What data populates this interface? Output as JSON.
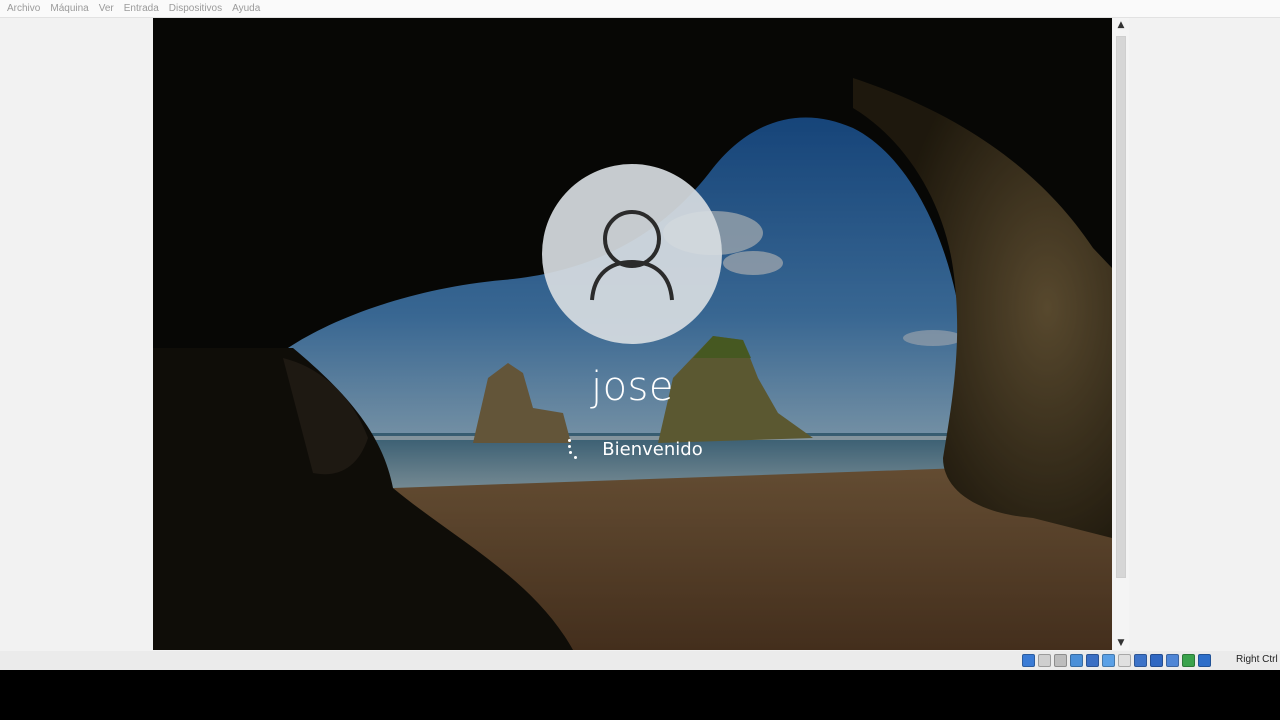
{
  "menubar": {
    "items": [
      "Archivo",
      "Máquina",
      "Ver",
      "Entrada",
      "Dispositivos",
      "Ayuda"
    ]
  },
  "login": {
    "avatar_icon": "user-icon",
    "username": "jose",
    "spinner_icon": "loading-spinner-icon",
    "status": "Bienvenido"
  },
  "statusbar": {
    "icons": [
      {
        "name": "hard-disk-icon",
        "color": "#3a7bd5"
      },
      {
        "name": "optical-drive-icon",
        "color": "#cfcfcf"
      },
      {
        "name": "floppy-icon",
        "color": "#bdbdbd"
      },
      {
        "name": "audio-icon",
        "color": "#4a8fd8"
      },
      {
        "name": "network-icon",
        "color": "#3b6fc4"
      },
      {
        "name": "usb-icon",
        "color": "#5aa0e6"
      },
      {
        "name": "shared-folders-icon",
        "color": "#e0e0e0"
      },
      {
        "name": "display-icon",
        "color": "#3d73c8"
      },
      {
        "name": "video-capture-icon",
        "color": "#2f67c2"
      },
      {
        "name": "cpu-icon",
        "color": "#4f86d6"
      },
      {
        "name": "guest-additions-icon",
        "color": "#3aa24c"
      },
      {
        "name": "mouse-integration-icon",
        "color": "#2d6ec9"
      }
    ],
    "host_key": "Right Ctrl"
  }
}
